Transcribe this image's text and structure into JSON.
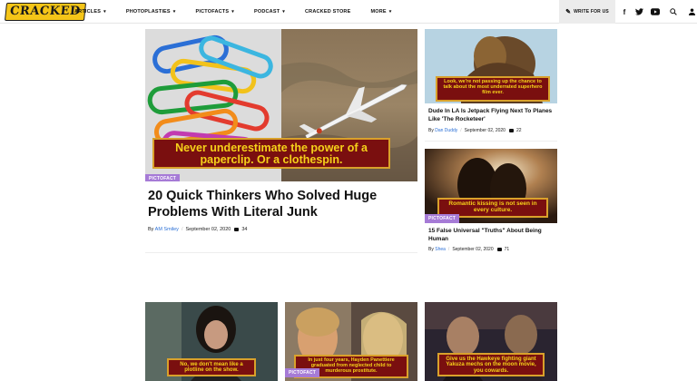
{
  "logo": "CRACKED",
  "nav": [
    {
      "label": "ARTICLES",
      "dropdown": true
    },
    {
      "label": "PHOTOPLASTIES",
      "dropdown": true
    },
    {
      "label": "PICTOFACTS",
      "dropdown": true
    },
    {
      "label": "PODCAST",
      "dropdown": true
    },
    {
      "label": "CRACKED STORE",
      "dropdown": false
    },
    {
      "label": "MORE",
      "dropdown": true
    }
  ],
  "write_for_us": "WRITE FOR US",
  "social_icons": [
    "facebook-icon",
    "twitter-icon",
    "youtube-icon",
    "search-icon",
    "user-icon"
  ],
  "caret": "▾",
  "featured": {
    "caption": "Never underestimate the power of a paperclip. Or a clothespin.",
    "tag": "PICTOFACT",
    "title": "20 Quick Thinkers Who Solved Huge Problems With Literal Junk",
    "by": "By",
    "author": "AM Smiley",
    "date": "September 02, 2020",
    "comments": "34"
  },
  "side_articles": [
    {
      "caption": "Look, we're not passing up the chance to talk about the most underrated superhero film ever.",
      "tag": "",
      "title": "Dude In LA Is Jetpack Flying Next To Planes Like 'The Rocketeer'",
      "by": "By",
      "author": "Dan Duddy",
      "date": "September 02, 2020",
      "comments": "22"
    },
    {
      "caption": "Romantic kissing is not seen in every culture.",
      "tag": "PICTOFACT",
      "title": "15 False Universal \"Truths\" About Being Human",
      "by": "By",
      "author": "Shea",
      "date": "September 02, 2020",
      "comments": "71"
    }
  ],
  "bottom_row": [
    {
      "caption": "No, we don't mean like a plotline on the show.",
      "tag": ""
    },
    {
      "caption": "In just four years, Hayden Panettiere graduated from neglected child to murderous prostitute.",
      "tag": "PICTOFACT"
    },
    {
      "caption": "Give us the Hawkeye fighting giant Yakuza mechs on the moon movie, you cowards.",
      "tag": ""
    }
  ],
  "colors": {
    "caption_bg": "#7a0f0f",
    "caption_border": "#d9a12b",
    "caption_text": "#f6d11a",
    "tag_bg": "#a67bd6",
    "author_link": "#2a6fd6"
  }
}
